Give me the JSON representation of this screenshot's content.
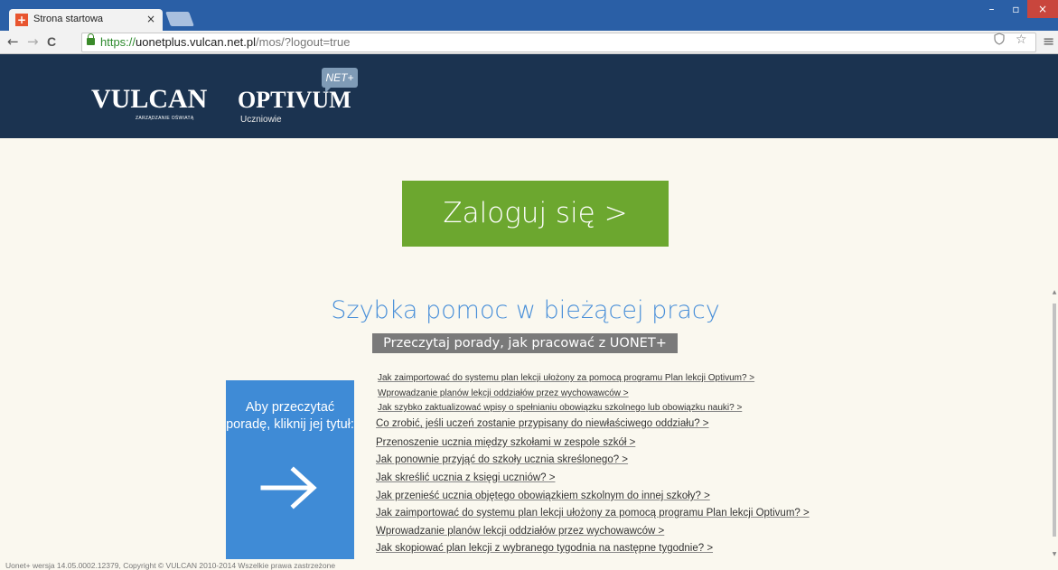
{
  "browser": {
    "tab_title": "Strona startowa",
    "tab_close": "×",
    "url_scheme": "https://",
    "url_host": "uonetplus.vulcan.net.pl",
    "url_path": "/mos/?logout=true",
    "window_controls": {
      "minimize": "–",
      "maximize": "▫",
      "close": "×"
    },
    "nav": {
      "back": "←",
      "forward": "→",
      "reload": "C"
    },
    "icons": [
      "lock-icon",
      "shield-icon",
      "star-icon",
      "menu-icon"
    ]
  },
  "header": {
    "vulcan_logo": "VULCAN",
    "vulcan_tagline": "ZARZĄDZANIE OŚWIATĄ",
    "optivum_logo": "OPTIVUM",
    "optivum_sub": "Uczniowie",
    "net_badge": "NET+"
  },
  "login": {
    "button_label": "Zaloguj się >"
  },
  "help": {
    "heading": "Szybka pomoc w bieżącej pracy",
    "tagline": "Przeczytaj porady, jak pracować z UONET+",
    "info_text": "Aby przeczytać poradę, kliknij jej tytuł:",
    "links": [
      "Jak zaimportować do systemu plan lekcji ułożony za pomocą programu Plan lekcji Optivum? >",
      "Wprowadzanie planów lekcji oddziałów przez wychowawców >",
      "Jak szybko zaktualizować wpisy o spełnianiu obowiązku szkolnego lub obowiązku nauki? >",
      "Co zrobić, jeśli uczeń zostanie przypisany do niewłaściwego oddziału? >",
      "Przenoszenie ucznia między szkołami w zespole szkół >",
      "Jak ponownie przyjąć do szkoły ucznia skreślonego? >",
      "Jak skreślić ucznia z księgi uczniów? >",
      "Jak przenieść ucznia objętego obowiązkiem szkolnym do innej szkoły? >",
      "Jak zaimportować do systemu plan lekcji ułożony za pomocą programu Plan lekcji Optivum? >",
      "Wprowadzanie planów lekcji oddziałów przez wychowawców >",
      "Jak skopiować plan lekcji z wybranego tygodnia na następne tygodnie? >"
    ]
  },
  "footer": {
    "text": "Uonet+ wersja 14.05.0002.12379, Copyright © VULCAN 2010-2014 Wszelkie prawa zastrzeżone"
  },
  "colors": {
    "titlebar": "#2a5fa6",
    "header_bg": "#1b3350",
    "login_green": "#6ca72f",
    "heading_blue": "#4a90d9",
    "info_blue": "#3f8bd6",
    "page_bg": "#faf8ef"
  }
}
